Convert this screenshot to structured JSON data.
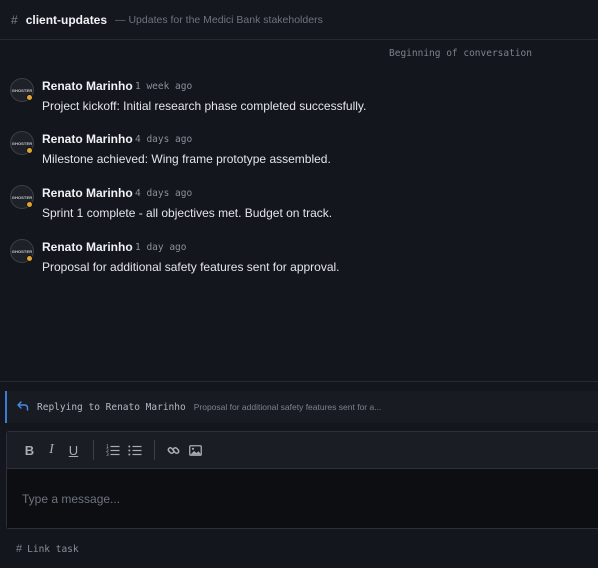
{
  "header": {
    "hash": "#",
    "channel": "client-updates",
    "description": "— Updates for the Medici Bank stakeholders"
  },
  "conversation": {
    "divider": "Beginning of conversation",
    "messages": [
      {
        "avatar_text": "GHOSTER",
        "author": "Renato Marinho",
        "time": "1 week ago",
        "text": "Project kickoff: Initial research phase completed successfully."
      },
      {
        "avatar_text": "GHOSTER",
        "author": "Renato Marinho",
        "time": "4 days ago",
        "text": "Milestone achieved: Wing frame prototype assembled."
      },
      {
        "avatar_text": "GHOSTER",
        "author": "Renato Marinho",
        "time": "4 days ago",
        "text": "Sprint 1 complete - all objectives met. Budget on track."
      },
      {
        "avatar_text": "GHOSTER",
        "author": "Renato Marinho",
        "time": "1 day ago",
        "text": "Proposal for additional safety features sent for approval."
      }
    ]
  },
  "reply": {
    "icon": "reply-arrow-icon",
    "label": "Replying to Renato Marinho",
    "preview": "Proposal for additional safety features sent for a..."
  },
  "composer": {
    "toolbar": {
      "bold": "B",
      "italic": "I",
      "underline": "U"
    },
    "placeholder": "Type a message...",
    "value": ""
  },
  "footer": {
    "hash": "#",
    "link_task_label": "Link task"
  },
  "colors": {
    "accent": "#3d7bd9",
    "status_away": "#e0a52a",
    "background": "#13161c"
  }
}
